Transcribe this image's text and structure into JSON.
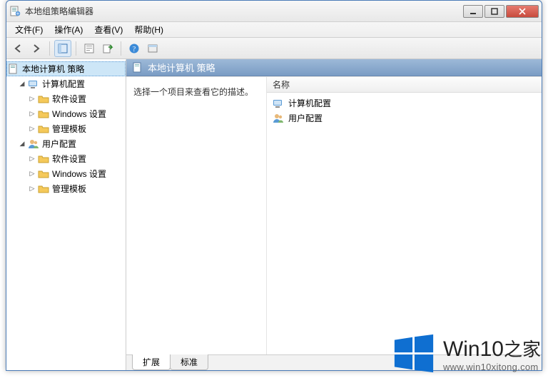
{
  "window": {
    "title": "本地组策略编辑器"
  },
  "menu": {
    "file": "文件(F)",
    "action": "操作(A)",
    "view": "查看(V)",
    "help": "帮助(H)"
  },
  "tree": {
    "root": "本地计算机 策略",
    "computer": "计算机配置",
    "user": "用户配置",
    "software": "软件设置",
    "windows": "Windows 设置",
    "templates": "管理模板"
  },
  "detail": {
    "header": "本地计算机 策略",
    "desc": "选择一个项目来查看它的描述。",
    "col_name": "名称",
    "items": {
      "computer": "计算机配置",
      "user": "用户配置"
    }
  },
  "tabs": {
    "extended": "扩展",
    "standard": "标准"
  },
  "watermark": {
    "brand_en": "Win10",
    "brand_zh": "之家",
    "url": "www.win10xitong.com"
  }
}
